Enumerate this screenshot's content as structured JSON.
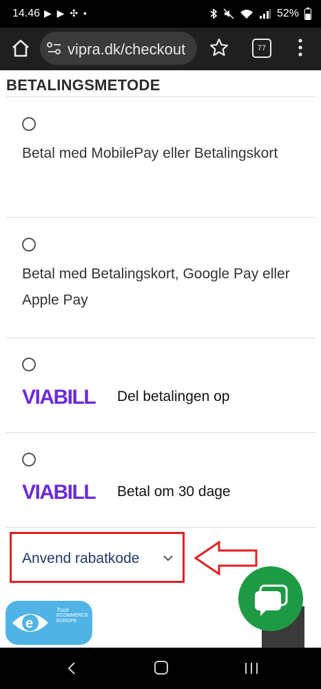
{
  "status_bar": {
    "time": "14.46",
    "notification_icons": "▶ ▶ ✣ •",
    "battery": "52%"
  },
  "browser": {
    "url": "vipra.dk/checkout",
    "tab_count": "77"
  },
  "payment": {
    "heading": "BETALINGSMETODE",
    "options": [
      {
        "label": "Betal med MobilePay eller Betalingskort"
      },
      {
        "label": "Betal med Betalingskort, Google Pay eller Apple Pay"
      },
      {
        "brand": "VIABILL",
        "label": "Del betalingen op"
      },
      {
        "brand": "VIABILL",
        "label": "Betal om 30 dage"
      }
    ]
  },
  "discount": {
    "label": "Anvend rabatkode"
  },
  "trust_badge": {
    "line1": "Trust",
    "line2": "ECOMMERCE",
    "line3": "EUROPE"
  },
  "colors": {
    "viabill_purple": "#6a2bd9",
    "annotation_red": "#e0201f",
    "chat_green": "#1e9a45",
    "badge_blue": "#4fb3e6"
  }
}
